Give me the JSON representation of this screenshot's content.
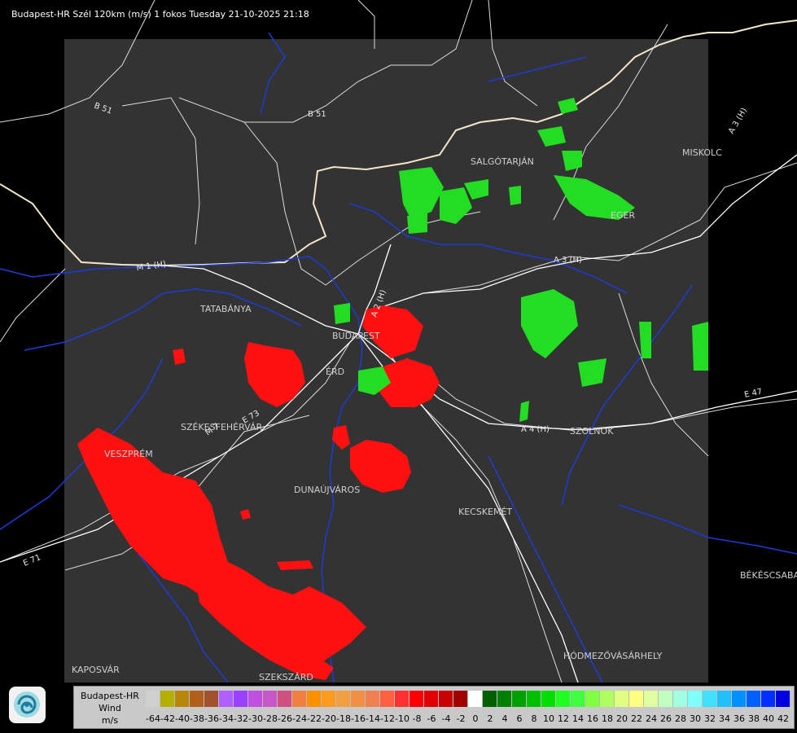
{
  "title": "Budapest-HR Szél 120km (m/s) 1 fokos Tuesday 21-10-2025 21:18",
  "cities": [
    "SALGÓTARJÁN",
    "EGER",
    "MISKOLC",
    "TATABÁNYA",
    "BUDAPEST",
    "ÉRD",
    "SZÉKESFEHÉRVÁR",
    "VESZPRÉM",
    "DUNAÚJVÁROS",
    "KECSKEMÉT",
    "SZOLNOK",
    "BÉKÉSCSABA",
    "HÓDMEZŐVÁSÁRHELY",
    "KAPOSVÁR",
    "SZEKSZÁRD"
  ],
  "roads": [
    "B 51",
    "B 51",
    "M 1 (H)",
    "A 2 (H)",
    "A 3 (H)",
    "A 3 (H)",
    "A 4 (H)",
    "E 47",
    "E 71",
    "E 73",
    "M 7"
  ],
  "legend": {
    "name": "Budapest-HR",
    "quantity": "Wind",
    "unit": "m/s",
    "labels": [
      "-64",
      "-42",
      "-40",
      "-38",
      "-36",
      "-34",
      "-32",
      "-30",
      "-28",
      "-26",
      "-24",
      "-22",
      "-20",
      "-18",
      "-16",
      "-14",
      "-12",
      "-10",
      "-8",
      "-6",
      "-4",
      "-2",
      "0",
      "2",
      "4",
      "6",
      "8",
      "10",
      "12",
      "14",
      "16",
      "18",
      "20",
      "22",
      "24",
      "26",
      "28",
      "30",
      "32",
      "34",
      "36",
      "38",
      "40",
      "42"
    ],
    "colors": [
      "#d0d0d0",
      "#b5b000",
      "#b8860b",
      "#b0601a",
      "#a0522d",
      "#b060ff",
      "#9a40ff",
      "#c050e0",
      "#c858c8",
      "#d05080",
      "#f08040",
      "#ff9000",
      "#ff9a20",
      "#f0a040",
      "#f09040",
      "#f08050",
      "#ff6040",
      "#ff3030",
      "#ff0000",
      "#e00000",
      "#c80000",
      "#a00000",
      "#ffffff",
      "#006000",
      "#008000",
      "#00a000",
      "#00c000",
      "#00e000",
      "#20ff20",
      "#40ff40",
      "#80ff40",
      "#b0ff60",
      "#e0ff80",
      "#ffff80",
      "#e0ffa0",
      "#c0ffc0",
      "#a0ffe0",
      "#80ffff",
      "#40e0ff",
      "#20c0ff",
      "#0090ff",
      "#0060ff",
      "#0030ff",
      "#0000e0"
    ]
  }
}
